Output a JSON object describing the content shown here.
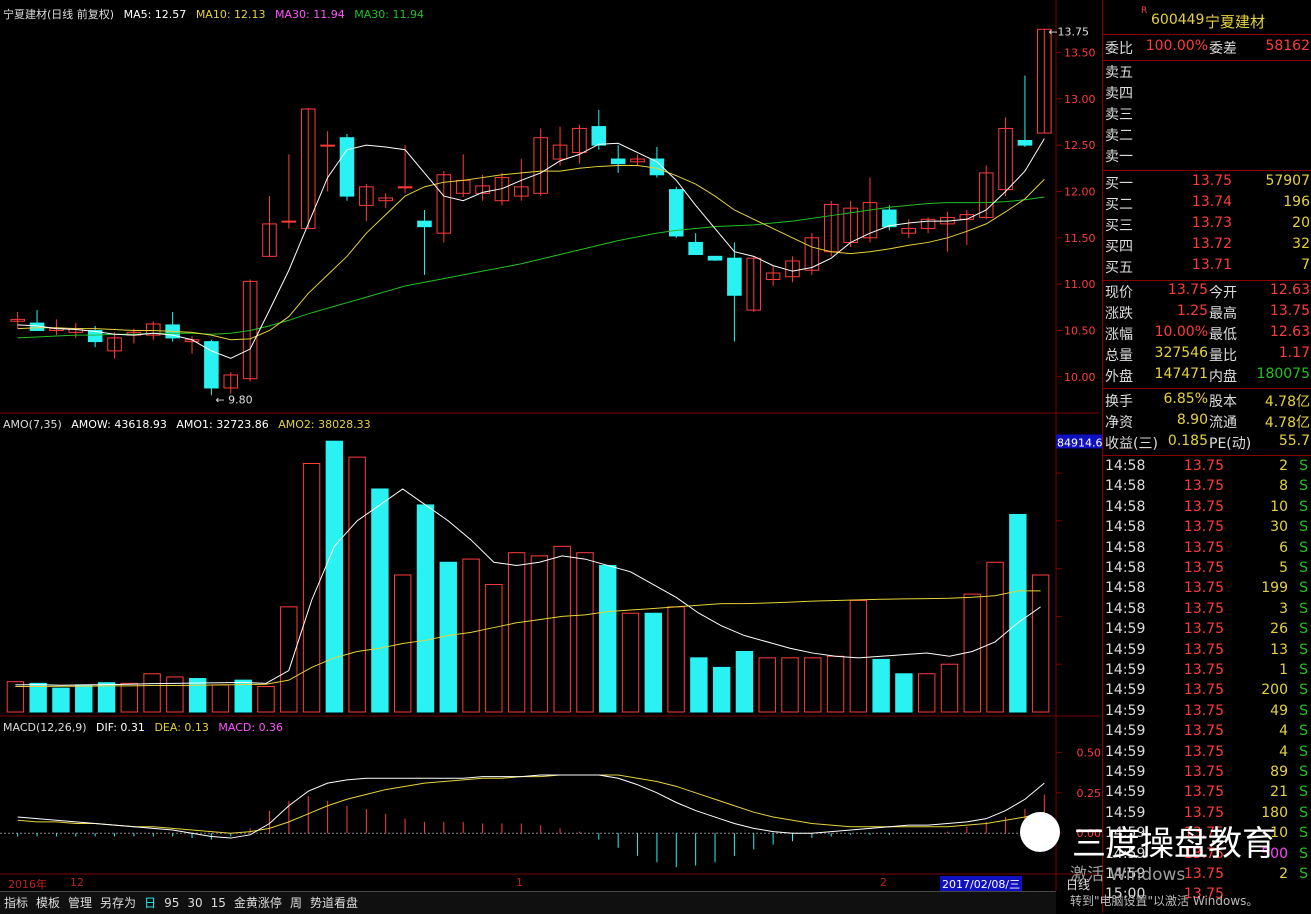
{
  "colors": {
    "up": "#ff3c3c",
    "down": "#2af2f2",
    "ma5": "#ffffff",
    "ma10": "#e6d23c",
    "ma30": "#22c022",
    "grid": "#7a0000",
    "price": "#ff3c3c",
    "volume": "#e6e63c",
    "flat": "#ffffff"
  },
  "main": {
    "title": "宁夏建材(日线 前复权)",
    "ma5": "MA5: 12.57",
    "ma10": "MA10: 12.13",
    "ma30a": "MA30: 11.94",
    "ma30b": "MA30: 11.94",
    "low_label": "9.80",
    "high_label": "13.75"
  },
  "amo": {
    "title": "AMO(7,35)",
    "amow": "AMOW: 43618.93",
    "amo1": "AMO1: 32723.86",
    "amo2": "AMO2: 38028.33",
    "max_label": "84914.62"
  },
  "macd": {
    "title": "MACD(12,26,9)",
    "dif": "DIF: 0.31",
    "dea": "DEA: 0.13",
    "macd": "MACD: 0.36"
  },
  "axis_bottom": {
    "year": "2016年",
    "m12": "12",
    "m1": "1",
    "m2": "2",
    "date": "2017/02/08/三"
  },
  "tabs": [
    "指标",
    "模板",
    "管理",
    "另存为",
    "日",
    "95",
    "30",
    "15",
    "金黄涨停",
    "周",
    "势道看盘"
  ],
  "chart_data": [
    {
      "type": "candlestick",
      "title": "宁夏建材(日线 前复权)",
      "y_ticks": [
        10.0,
        10.5,
        11.0,
        11.5,
        12.0,
        12.5,
        13.0,
        13.5
      ],
      "ylim": [
        9.75,
        13.85
      ],
      "series": [
        {
          "o": 10.6,
          "h": 10.7,
          "l": 10.52,
          "c": 10.62
        },
        {
          "o": 10.58,
          "h": 10.72,
          "l": 10.5,
          "c": 10.5
        },
        {
          "o": 10.5,
          "h": 10.62,
          "l": 10.45,
          "c": 10.52
        },
        {
          "o": 10.48,
          "h": 10.58,
          "l": 10.42,
          "c": 10.52
        },
        {
          "o": 10.5,
          "h": 10.55,
          "l": 10.32,
          "c": 10.38
        },
        {
          "o": 10.28,
          "h": 10.48,
          "l": 10.2,
          "c": 10.42
        },
        {
          "o": 10.45,
          "h": 10.52,
          "l": 10.36,
          "c": 10.48
        },
        {
          "o": 10.45,
          "h": 10.6,
          "l": 10.4,
          "c": 10.57
        },
        {
          "o": 10.56,
          "h": 10.7,
          "l": 10.38,
          "c": 10.42
        },
        {
          "o": 10.38,
          "h": 10.44,
          "l": 10.25,
          "c": 10.4
        },
        {
          "o": 10.38,
          "h": 10.4,
          "l": 9.8,
          "c": 9.88
        },
        {
          "o": 9.88,
          "h": 10.05,
          "l": 9.82,
          "c": 10.02
        },
        {
          "o": 9.98,
          "h": 11.05,
          "l": 9.95,
          "c": 11.03
        },
        {
          "o": 11.3,
          "h": 11.95,
          "l": 11.3,
          "c": 11.65
        },
        {
          "o": 11.68,
          "h": 12.4,
          "l": 11.6,
          "c": 11.68
        },
        {
          "o": 11.6,
          "h": 12.9,
          "l": 11.6,
          "c": 12.89
        },
        {
          "o": 12.5,
          "h": 12.65,
          "l": 12.0,
          "c": 12.5
        },
        {
          "o": 12.58,
          "h": 12.62,
          "l": 11.9,
          "c": 11.95
        },
        {
          "o": 11.85,
          "h": 12.08,
          "l": 11.68,
          "c": 12.05
        },
        {
          "o": 11.9,
          "h": 11.98,
          "l": 11.82,
          "c": 11.93
        },
        {
          "o": 12.05,
          "h": 12.5,
          "l": 11.98,
          "c": 12.05
        },
        {
          "o": 11.68,
          "h": 11.8,
          "l": 11.1,
          "c": 11.62
        },
        {
          "o": 11.55,
          "h": 12.22,
          "l": 11.45,
          "c": 12.18
        },
        {
          "o": 11.98,
          "h": 12.4,
          "l": 11.94,
          "c": 12.12
        },
        {
          "o": 11.98,
          "h": 12.18,
          "l": 11.9,
          "c": 12.06
        },
        {
          "o": 11.9,
          "h": 12.2,
          "l": 11.85,
          "c": 12.15
        },
        {
          "o": 11.95,
          "h": 12.35,
          "l": 11.9,
          "c": 12.05
        },
        {
          "o": 11.98,
          "h": 12.68,
          "l": 11.95,
          "c": 12.58
        },
        {
          "o": 12.35,
          "h": 12.7,
          "l": 12.28,
          "c": 12.5
        },
        {
          "o": 12.42,
          "h": 12.72,
          "l": 12.3,
          "c": 12.68
        },
        {
          "o": 12.7,
          "h": 12.88,
          "l": 12.45,
          "c": 12.5
        },
        {
          "o": 12.35,
          "h": 12.5,
          "l": 12.2,
          "c": 12.3
        },
        {
          "o": 12.32,
          "h": 12.4,
          "l": 12.28,
          "c": 12.35
        },
        {
          "o": 12.35,
          "h": 12.48,
          "l": 12.15,
          "c": 12.18
        },
        {
          "o": 12.02,
          "h": 12.05,
          "l": 11.5,
          "c": 11.52
        },
        {
          "o": 11.45,
          "h": 11.55,
          "l": 11.35,
          "c": 11.32
        },
        {
          "o": 11.3,
          "h": 11.3,
          "l": 11.25,
          "c": 11.26
        },
        {
          "o": 11.28,
          "h": 11.45,
          "l": 10.38,
          "c": 10.88
        },
        {
          "o": 10.72,
          "h": 11.3,
          "l": 10.7,
          "c": 11.28
        },
        {
          "o": 11.05,
          "h": 11.2,
          "l": 10.98,
          "c": 11.12
        },
        {
          "o": 11.08,
          "h": 11.3,
          "l": 11.02,
          "c": 11.25
        },
        {
          "o": 11.15,
          "h": 11.55,
          "l": 11.1,
          "c": 11.5
        },
        {
          "o": 11.35,
          "h": 11.9,
          "l": 11.3,
          "c": 11.86
        },
        {
          "o": 11.45,
          "h": 11.9,
          "l": 11.4,
          "c": 11.82
        },
        {
          "o": 11.5,
          "h": 12.15,
          "l": 11.45,
          "c": 11.88
        },
        {
          "o": 11.8,
          "h": 11.85,
          "l": 11.58,
          "c": 11.62
        },
        {
          "o": 11.55,
          "h": 11.7,
          "l": 11.5,
          "c": 11.6
        },
        {
          "o": 11.6,
          "h": 11.72,
          "l": 11.55,
          "c": 11.7
        },
        {
          "o": 11.65,
          "h": 11.78,
          "l": 11.35,
          "c": 11.72
        },
        {
          "o": 11.7,
          "h": 11.8,
          "l": 11.42,
          "c": 11.75
        },
        {
          "o": 11.72,
          "h": 12.28,
          "l": 11.7,
          "c": 12.2
        },
        {
          "o": 12.02,
          "h": 12.8,
          "l": 11.95,
          "c": 12.68
        },
        {
          "o": 12.55,
          "h": 13.25,
          "l": 12.48,
          "c": 12.5
        },
        {
          "o": 12.63,
          "h": 13.75,
          "l": 12.63,
          "c": 13.75
        }
      ],
      "ma5": [
        10.56,
        10.55,
        10.52,
        10.51,
        10.49,
        10.46,
        10.45,
        10.47,
        10.45,
        10.4,
        10.28,
        10.2,
        10.3,
        10.72,
        11.15,
        11.65,
        12.15,
        12.45,
        12.5,
        12.48,
        12.45,
        12.2,
        11.95,
        11.9,
        11.99,
        12.03,
        12.12,
        12.2,
        12.33,
        12.4,
        12.51,
        12.52,
        12.42,
        12.32,
        12.12,
        11.85,
        11.6,
        11.35,
        11.3,
        11.2,
        11.14,
        11.18,
        11.28,
        11.45,
        11.55,
        11.63,
        11.66,
        11.68,
        11.68,
        11.7,
        11.8,
        12.0,
        12.22,
        12.57
      ],
      "ma10": [
        10.52,
        10.53,
        10.53,
        10.52,
        10.52,
        10.51,
        10.5,
        10.5,
        10.49,
        10.48,
        10.45,
        10.4,
        10.41,
        10.5,
        10.65,
        10.9,
        11.1,
        11.3,
        11.55,
        11.75,
        11.95,
        12.05,
        12.1,
        12.12,
        12.15,
        12.18,
        12.2,
        12.22,
        12.22,
        12.25,
        12.27,
        12.28,
        12.28,
        12.25,
        12.17,
        12.08,
        11.95,
        11.8,
        11.7,
        11.6,
        11.5,
        11.4,
        11.35,
        11.33,
        11.35,
        11.38,
        11.42,
        11.45,
        11.5,
        11.57,
        11.65,
        11.78,
        11.92,
        12.13
      ],
      "ma30": [
        10.42,
        10.43,
        10.44,
        10.45,
        10.45,
        10.46,
        10.46,
        10.47,
        10.47,
        10.47,
        10.46,
        10.47,
        10.5,
        10.55,
        10.61,
        10.68,
        10.74,
        10.8,
        10.86,
        10.92,
        10.98,
        11.02,
        11.06,
        11.1,
        11.14,
        11.18,
        11.22,
        11.27,
        11.32,
        11.37,
        11.42,
        11.47,
        11.51,
        11.55,
        11.58,
        11.6,
        11.62,
        11.63,
        11.64,
        11.66,
        11.68,
        11.71,
        11.74,
        11.77,
        11.8,
        11.83,
        11.85,
        11.87,
        11.88,
        11.88,
        11.88,
        11.89,
        11.91,
        11.94
      ]
    },
    {
      "type": "bar",
      "title": "AMO(7,35)",
      "y_ticks": [
        15000,
        30000,
        45000,
        60000,
        75000
      ],
      "ylim": [
        0,
        86000
      ],
      "values": [
        9500,
        9000,
        7500,
        8500,
        9200,
        9000,
        12000,
        11000,
        10500,
        8500,
        10000,
        8000,
        33000,
        78000,
        85000,
        80000,
        70000,
        43000,
        65000,
        47000,
        48000,
        40000,
        50000,
        49000,
        52000,
        50000,
        46000,
        31000,
        31000,
        33000,
        17000,
        14000,
        19000,
        17000,
        17000,
        17000,
        17500,
        35000,
        16500,
        12000,
        12000,
        15000,
        37000,
        47000,
        62000,
        43000
      ],
      "colors": [
        "up",
        "down",
        "down",
        "down",
        "down",
        "up",
        "up",
        "up",
        "down",
        "up",
        "down",
        "up",
        "up",
        "up",
        "down",
        "up",
        "down",
        "up",
        "down",
        "down",
        "up",
        "up",
        "up",
        "up",
        "up",
        "up",
        "down",
        "up",
        "down",
        "up",
        "down",
        "down",
        "down",
        "up",
        "up",
        "up",
        "up",
        "up",
        "down",
        "down",
        "up",
        "up",
        "up",
        "up",
        "down",
        "up"
      ],
      "amo1": [
        8500,
        8600,
        8400,
        8500,
        8600,
        8700,
        8900,
        9000,
        9100,
        9200,
        9300,
        9000,
        13000,
        35000,
        52000,
        60000,
        65000,
        70000,
        65000,
        60000,
        54000,
        47000,
        46000,
        47000,
        49000,
        48000,
        46000,
        44000,
        40000,
        36000,
        31000,
        27000,
        24000,
        22000,
        20000,
        18500,
        17500,
        17000,
        17500,
        18000,
        18500,
        17500,
        19000,
        22000,
        28000,
        33000
      ],
      "amo2": [
        8000,
        8000,
        8100,
        8100,
        8200,
        8200,
        8300,
        8300,
        8400,
        8500,
        8600,
        8700,
        10000,
        14000,
        17000,
        19000,
        20000,
        21500,
        22500,
        24000,
        25000,
        26500,
        28000,
        29000,
        30000,
        30500,
        31500,
        32000,
        32500,
        33000,
        33500,
        34000,
        34000,
        34200,
        34500,
        34800,
        35000,
        35200,
        35400,
        35500,
        35600,
        35700,
        36000,
        36500,
        38000,
        38000
      ]
    },
    {
      "type": "bar",
      "title": "MACD(12,26,9)",
      "y_ticks": [
        0.0,
        0.25,
        0.5
      ],
      "ylim": [
        -0.24,
        0.62
      ],
      "values": [
        -0.02,
        -0.02,
        -0.02,
        -0.02,
        -0.02,
        -0.02,
        -0.02,
        -0.02,
        -0.02,
        -0.03,
        -0.04,
        -0.02,
        0.03,
        0.14,
        0.2,
        0.23,
        0.2,
        0.17,
        0.15,
        0.12,
        0.09,
        0.07,
        0.07,
        0.07,
        0.06,
        0.06,
        0.06,
        0.05,
        0.03,
        0.01,
        -0.04,
        -0.09,
        -0.14,
        -0.18,
        -0.21,
        -0.2,
        -0.18,
        -0.14,
        -0.1,
        -0.07,
        -0.05,
        -0.03,
        -0.02,
        -0.01,
        -0.01,
        -0.01,
        0.0,
        0.0,
        0.01,
        0.04,
        0.07,
        0.1,
        0.15,
        0.24
      ],
      "dif": [
        0.1,
        0.09,
        0.08,
        0.07,
        0.06,
        0.05,
        0.04,
        0.03,
        0.02,
        0.0,
        -0.02,
        -0.03,
        -0.01,
        0.06,
        0.17,
        0.26,
        0.31,
        0.33,
        0.34,
        0.34,
        0.34,
        0.34,
        0.34,
        0.34,
        0.35,
        0.35,
        0.35,
        0.36,
        0.36,
        0.36,
        0.36,
        0.34,
        0.3,
        0.25,
        0.19,
        0.14,
        0.1,
        0.06,
        0.03,
        0.01,
        0.0,
        0.0,
        0.01,
        0.02,
        0.03,
        0.04,
        0.05,
        0.05,
        0.06,
        0.07,
        0.09,
        0.14,
        0.21,
        0.31
      ],
      "dea": [
        0.08,
        0.07,
        0.07,
        0.06,
        0.06,
        0.05,
        0.04,
        0.04,
        0.03,
        0.02,
        0.01,
        0.0,
        0.01,
        0.03,
        0.07,
        0.12,
        0.17,
        0.21,
        0.24,
        0.27,
        0.29,
        0.31,
        0.32,
        0.33,
        0.34,
        0.34,
        0.35,
        0.35,
        0.36,
        0.36,
        0.36,
        0.36,
        0.34,
        0.32,
        0.29,
        0.25,
        0.21,
        0.17,
        0.13,
        0.1,
        0.08,
        0.06,
        0.05,
        0.04,
        0.04,
        0.04,
        0.04,
        0.04,
        0.04,
        0.05,
        0.06,
        0.08,
        0.1,
        0.13
      ]
    }
  ],
  "sidebar": {
    "logo": "R",
    "code": "600449",
    "name": "宁夏建材",
    "wb_label": "委比",
    "wb_val": "100.00%",
    "wc_label": "委差",
    "wc_val": "58162",
    "sells": [
      "卖五",
      "卖四",
      "卖三",
      "卖二",
      "卖一"
    ],
    "buys": [
      {
        "l": "买一",
        "p": "13.75",
        "v": "57907"
      },
      {
        "l": "买二",
        "p": "13.74",
        "v": "196"
      },
      {
        "l": "买三",
        "p": "13.73",
        "v": "20"
      },
      {
        "l": "买四",
        "p": "13.72",
        "v": "32"
      },
      {
        "l": "买五",
        "p": "13.71",
        "v": "7"
      }
    ],
    "stats": [
      {
        "a": "现价",
        "b": "13.75",
        "c": "今开",
        "d": "12.63"
      },
      {
        "a": "涨跌",
        "b": "1.25",
        "c": "最高",
        "d": "13.75"
      },
      {
        "a": "涨幅",
        "b": "10.00%",
        "c": "最低",
        "d": "12.63"
      },
      {
        "a": "总量",
        "b": "327546",
        "c": "量比",
        "d": "1.17"
      },
      {
        "a": "外盘",
        "b": "147471",
        "c": "内盘",
        "d": "180075"
      }
    ],
    "fund": [
      {
        "a": "换手",
        "b": "6.85%",
        "c": "股本",
        "d": "4.78亿"
      },
      {
        "a": "净资",
        "b": "8.90",
        "c": "流通",
        "d": "4.78亿"
      },
      {
        "a": "收益(三)",
        "b": "0.185",
        "c": "PE(动)",
        "d": "55.7"
      }
    ],
    "ticks": [
      {
        "t": "14:58",
        "p": "13.75",
        "v": "2",
        "s": "S"
      },
      {
        "t": "14:58",
        "p": "13.75",
        "v": "8",
        "s": "S"
      },
      {
        "t": "14:58",
        "p": "13.75",
        "v": "10",
        "s": "S"
      },
      {
        "t": "14:58",
        "p": "13.75",
        "v": "30",
        "s": "S"
      },
      {
        "t": "14:58",
        "p": "13.75",
        "v": "6",
        "s": "S"
      },
      {
        "t": "14:58",
        "p": "13.75",
        "v": "5",
        "s": "S"
      },
      {
        "t": "14:58",
        "p": "13.75",
        "v": "199",
        "s": "S"
      },
      {
        "t": "14:58",
        "p": "13.75",
        "v": "3",
        "s": "S"
      },
      {
        "t": "14:59",
        "p": "13.75",
        "v": "26",
        "s": "S"
      },
      {
        "t": "14:59",
        "p": "13.75",
        "v": "13",
        "s": "S"
      },
      {
        "t": "14:59",
        "p": "13.75",
        "v": "1",
        "s": "S"
      },
      {
        "t": "14:59",
        "p": "13.75",
        "v": "200",
        "s": "S"
      },
      {
        "t": "14:59",
        "p": "13.75",
        "v": "49",
        "s": "S"
      },
      {
        "t": "14:59",
        "p": "13.75",
        "v": "4",
        "s": "S"
      },
      {
        "t": "14:59",
        "p": "13.75",
        "v": "4",
        "s": "S"
      },
      {
        "t": "14:59",
        "p": "13.75",
        "v": "89",
        "s": "S"
      },
      {
        "t": "14:59",
        "p": "13.75",
        "v": "21",
        "s": "S"
      },
      {
        "t": "14:59",
        "p": "13.75",
        "v": "180",
        "s": "S"
      },
      {
        "t": "14:59",
        "p": "13.75",
        "v": "10",
        "s": "S"
      },
      {
        "t": "14:59",
        "p": "13.75",
        "v": "500",
        "s": "S"
      },
      {
        "t": "14:59",
        "p": "13.75",
        "v": "2",
        "s": "S"
      },
      {
        "t": "15:00",
        "p": "13.75",
        "v": "",
        "s": ""
      }
    ]
  },
  "overlay": {
    "brand": "三度操盘教育",
    "activate1": "激活 Windows",
    "activate2": "转到\"电脑设置\"以激活 Windows。",
    "fenxian": "日线"
  }
}
